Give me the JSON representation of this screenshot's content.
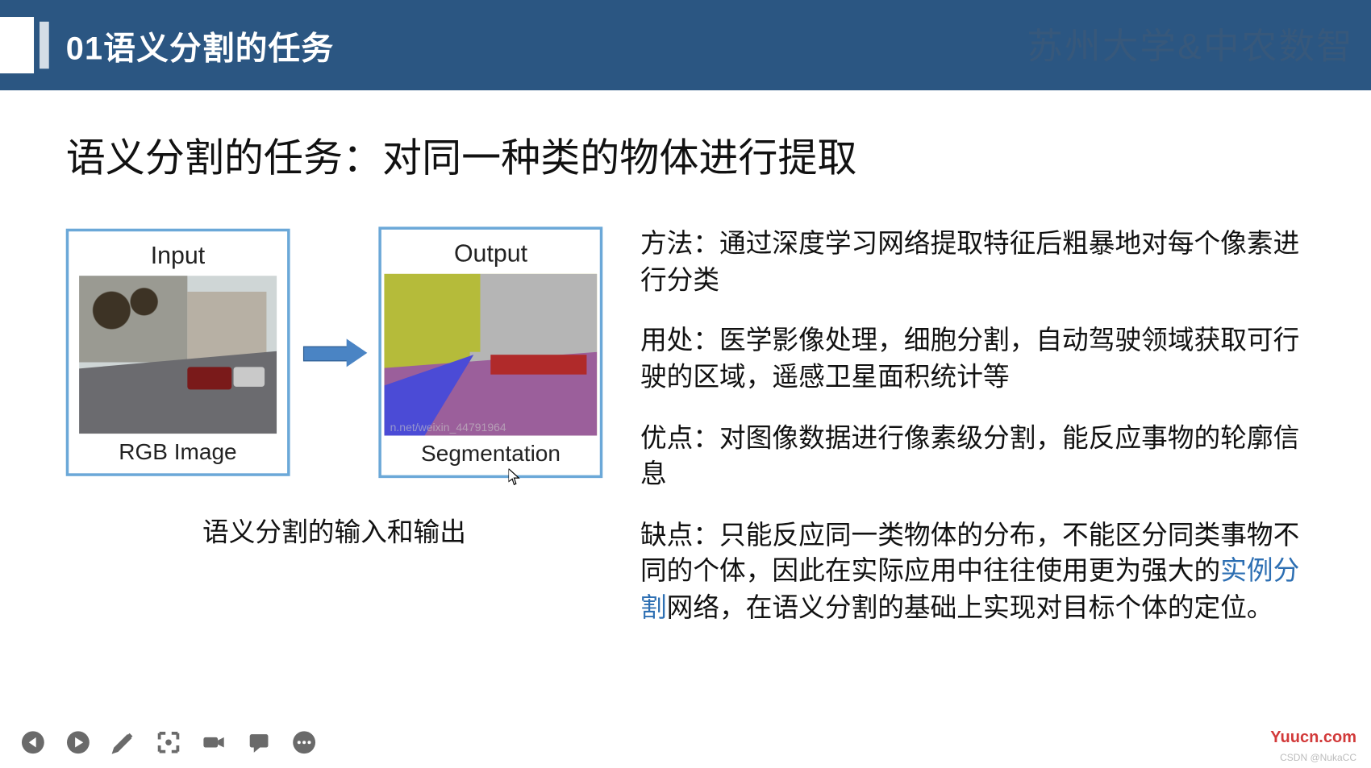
{
  "header": {
    "section_number": "01",
    "section_title": "语义分割的任务",
    "watermark": "苏州大学&中农数智"
  },
  "main_title": "语义分割的任务：对同一种类的物体进行提取",
  "io": {
    "input_label_top": "Input",
    "input_label_bottom": "RGB Image",
    "output_label_top": "Output",
    "output_label_bottom": "Segmentation",
    "seg_inner_wm": "n.net/weixin_44791964",
    "caption": "语义分割的输入和输出"
  },
  "paragraphs": {
    "p1": "方法：通过深度学习网络提取特征后粗暴地对每个像素进行分类",
    "p2": "用处：医学影像处理，细胞分割，自动驾驶领域获取可行驶的区域，遥感卫星面积统计等",
    "p3": "优点：对图像数据进行像素级分割，能反应事物的轮廓信息",
    "p4_a": "缺点：只能反应同一类物体的分布，不能区分同类事物不同的个体，因此在实际应用中往往使用更为强大的",
    "p4_link": "实例分割",
    "p4_b": "网络，在语义分割的基础上实现对目标个体的定位。"
  },
  "footer": {
    "yuucn": "Yuucn.com",
    "csdn": "CSDN @NukaCC"
  }
}
